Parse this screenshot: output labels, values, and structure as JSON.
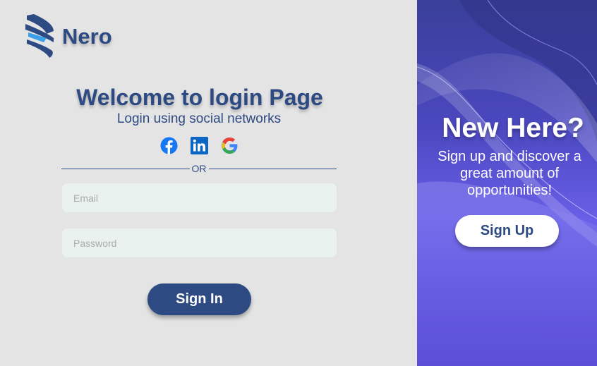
{
  "brand": {
    "name": "Nero",
    "logo_icon": "nero-logo-icon",
    "color": "#2e4a82"
  },
  "login": {
    "title": "Welcome to login Page",
    "subtitle": "Login using social networks",
    "social": [
      {
        "name": "facebook",
        "icon": "facebook-icon"
      },
      {
        "name": "linkedin",
        "icon": "linkedin-icon"
      },
      {
        "name": "google",
        "icon": "google-icon"
      }
    ],
    "divider_text": "OR",
    "email_placeholder": "Email",
    "password_placeholder": "Password",
    "submit_label": "Sign In"
  },
  "signup_panel": {
    "title": "New Here?",
    "description": "Sign up and discover a great amount of opportunities!",
    "button_label": "Sign Up",
    "colors": {
      "gradient_top": "#3a3f99",
      "gradient_bottom": "#6a5fe8"
    }
  },
  "colors": {
    "primary": "#2e4a82",
    "background": "#e4e4e4",
    "input_background": "#eaf2ef"
  }
}
